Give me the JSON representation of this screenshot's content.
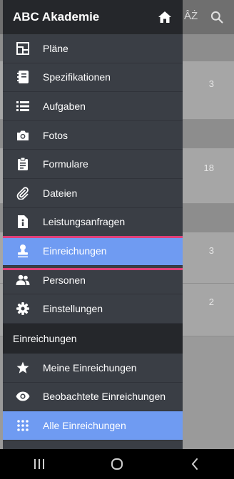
{
  "app": {
    "title": "ABC Akademie"
  },
  "background": {
    "sort_label": "ÂŻ",
    "counts": [
      "3",
      "18",
      "3",
      "2"
    ]
  },
  "drawer": {
    "items": [
      {
        "label": "Pläne",
        "icon": "plans-icon"
      },
      {
        "label": "Spezifikationen",
        "icon": "specifications-icon"
      },
      {
        "label": "Aufgaben",
        "icon": "tasks-icon"
      },
      {
        "label": "Fotos",
        "icon": "camera-icon"
      },
      {
        "label": "Formulare",
        "icon": "clipboard-icon"
      },
      {
        "label": "Dateien",
        "icon": "paperclip-icon"
      },
      {
        "label": "Leistungsanfragen",
        "icon": "info-document-icon"
      },
      {
        "label": "Einreichungen",
        "icon": "stamp-icon"
      },
      {
        "label": "Personen",
        "icon": "people-icon"
      },
      {
        "label": "Einstellungen",
        "icon": "gear-icon"
      }
    ],
    "section_title": "Einreichungen",
    "sub_items": [
      {
        "label": "Meine Einreichungen",
        "icon": "star-icon"
      },
      {
        "label": "Beobachtete Einreichungen",
        "icon": "eye-icon"
      },
      {
        "label": "Alle Einreichungen",
        "icon": "grid-icon"
      }
    ]
  },
  "colors": {
    "drawer_bg": "#3a3e45",
    "header_bg": "#25272b",
    "active_bg": "#6f9bf2",
    "highlight_border": "#e0407a"
  }
}
